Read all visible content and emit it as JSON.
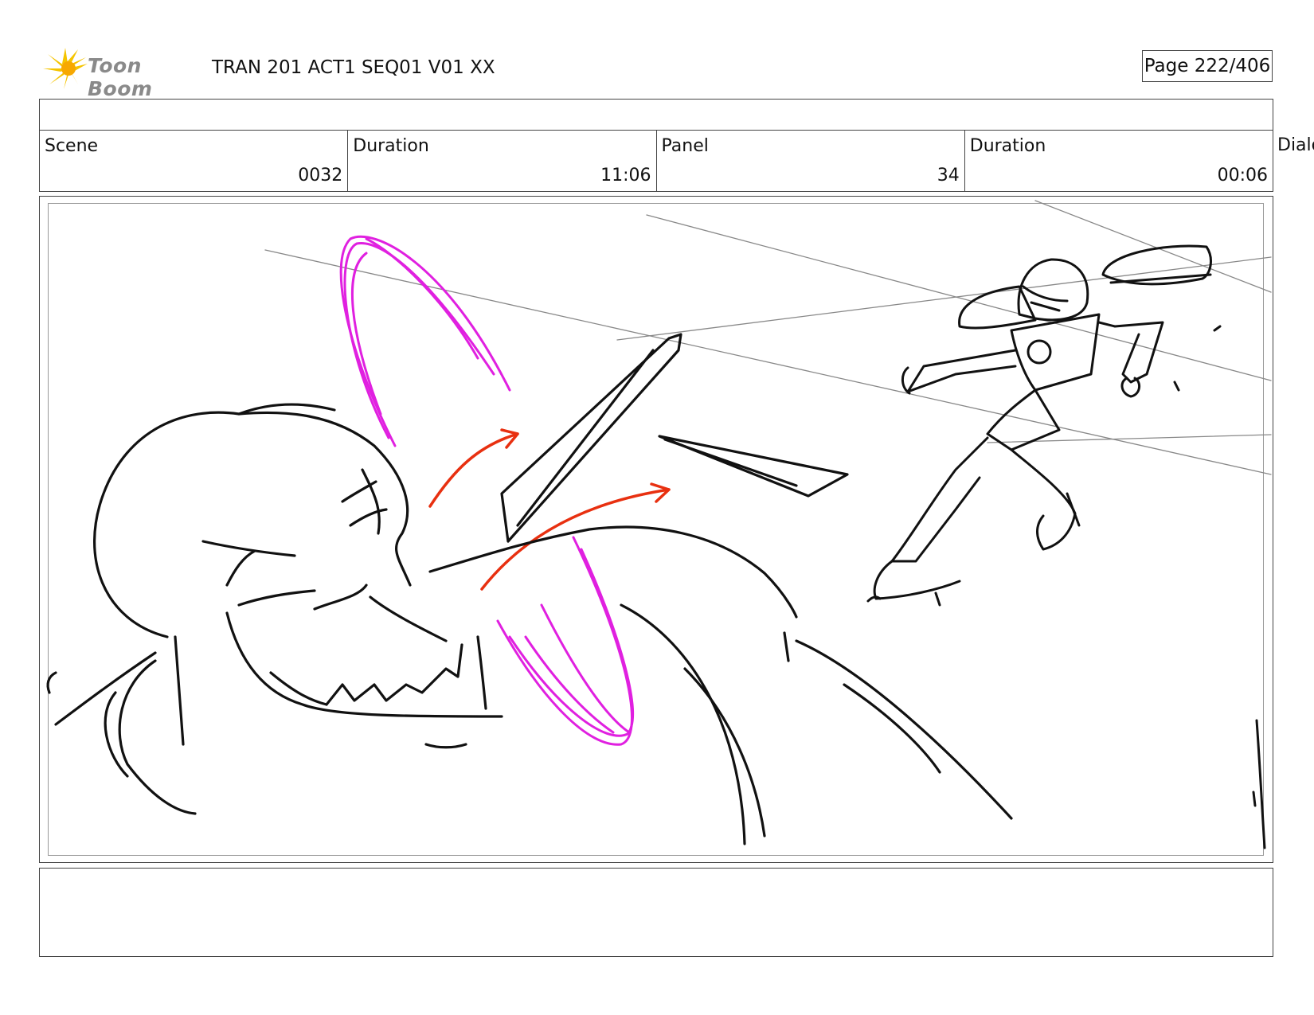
{
  "header": {
    "logo_text": "Toon Boom",
    "title": "TRAN 201 ACT1 SEQ01 V01 XX",
    "page": "Page 222/406"
  },
  "info": {
    "scene_label": "Scene",
    "scene_value": "0032",
    "scene_duration_label": "Duration",
    "scene_duration_value": "11:06",
    "panel_label": "Panel",
    "panel_value": "34",
    "panel_duration_label": "Duration",
    "panel_duration_value": "00:06",
    "dialog_label": "Dialog"
  },
  "colors": {
    "sketch": "#111111",
    "effect_magenta": "#e020e0",
    "arrow_red": "#e83010",
    "logo_star": "#f5c400"
  }
}
